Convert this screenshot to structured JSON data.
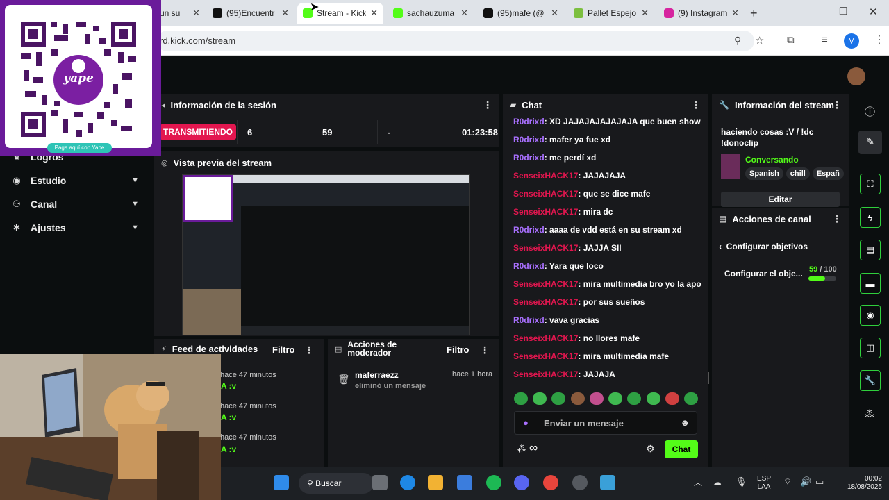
{
  "browser": {
    "tabs": [
      {
        "title": "un su",
        "color": "#e8e8e8"
      },
      {
        "title": "(95)Encuentr",
        "color": "#111111"
      },
      {
        "title": "Stream - Kick",
        "color": "#53fc18"
      },
      {
        "title": "sachauzuma",
        "color": "#53fc18"
      },
      {
        "title": "(95)mafe (@",
        "color": "#111111"
      },
      {
        "title": "Pallet Espejo",
        "color": "#7cbf3f"
      },
      {
        "title": "(9) Instagram",
        "color": "#d6249f"
      }
    ],
    "url": "rd.kick.com/stream",
    "profile_initial": "M"
  },
  "overlay_qr": {
    "brand": "yape",
    "caption": "Paga aquí con Yape"
  },
  "sidebar": {
    "items": [
      {
        "label": "Logros",
        "icon": "trophy-icon",
        "expandable": false
      },
      {
        "label": "Estudio",
        "icon": "video-icon",
        "expandable": true
      },
      {
        "label": "Canal",
        "icon": "users-icon",
        "expandable": true
      },
      {
        "label": "Ajustes",
        "icon": "gear-icon",
        "expandable": true
      }
    ]
  },
  "session": {
    "title": "Información de la sesión",
    "live_badge": "TRANSMITIENDO",
    "stats": [
      "6",
      "59",
      "-",
      "01:23:58"
    ]
  },
  "preview": {
    "title": "Vista previa del stream"
  },
  "activity": {
    "title": "Feed de actividades",
    "filter": "Filtro",
    "items": [
      {
        "text": "A :v",
        "time": "hace 47 minutos"
      },
      {
        "text": "A :v",
        "time": "hace 47 minutos"
      },
      {
        "text": "A :v",
        "time": "hace 47 minutos"
      }
    ]
  },
  "modactions": {
    "title_line1": "Acciones de",
    "title_line2": "moderador",
    "filter": "Filtro",
    "items": [
      {
        "user": "maferraezz",
        "action": "eliminó un mensaje",
        "time": "hace 1 hora"
      }
    ]
  },
  "chat": {
    "title": "Chat",
    "messages": [
      {
        "user": "R0drixd",
        "color": "#a970ff",
        "text": "XD JAJAJAJAJAJAJA que buen show"
      },
      {
        "user": "R0drixd",
        "color": "#a970ff",
        "text": "mafer ya fue xd"
      },
      {
        "user": "R0drixd",
        "color": "#a970ff",
        "text": "me perdí xd"
      },
      {
        "user": "SenseixHACK17",
        "color": "#e3164f",
        "text": "JAJAJAJA"
      },
      {
        "user": "SenseixHACK17",
        "color": "#e3164f",
        "text": "que se dice mafe"
      },
      {
        "user": "SenseixHACK17",
        "color": "#e3164f",
        "text": "mira dc"
      },
      {
        "user": "R0drixd",
        "color": "#a970ff",
        "text": "aaaa de vdd está en su stream xd"
      },
      {
        "user": "SenseixHACK17",
        "color": "#e3164f",
        "text": "JAJJA SII"
      },
      {
        "user": "R0drixd",
        "color": "#a970ff",
        "text": "Yara que loco"
      },
      {
        "user": "SenseixHACK17",
        "color": "#e3164f",
        "text": "mira multimedia bro yo la apoye"
      },
      {
        "user": "SenseixHACK17",
        "color": "#e3164f",
        "text": "por sus sueños"
      },
      {
        "user": "R0drixd",
        "color": "#a970ff",
        "text": "vava gracias"
      },
      {
        "user": "SenseixHACK17",
        "color": "#e3164f",
        "text": "no llores mafe"
      },
      {
        "user": "SenseixHACK17",
        "color": "#e3164f",
        "text": "mira multimedia mafe"
      },
      {
        "user": "SenseixHACK17",
        "color": "#e3164f",
        "text": "JAJAJA"
      }
    ],
    "input_placeholder": "Enviar un mensaje",
    "infinity": "∞",
    "send_label": "Chat"
  },
  "stream_info": {
    "title": "Información del stream",
    "stream_title": "haciendo cosas :V / !dc !donoclip",
    "category": "Conversando",
    "tags": [
      "Spanish",
      "chill",
      "Españ"
    ],
    "edit_label": "Editar"
  },
  "channel_actions": {
    "title": "Acciones de canal",
    "back_label": "Configurar objetivos",
    "goal_label": "Configurar el obje...",
    "goal_current": "59",
    "goal_total": "/ 100",
    "goal_fraction": 0.59
  },
  "taskbar": {
    "search_label": "Buscar",
    "lang_line1": "ESP",
    "lang_line2": "LAA",
    "time": "00:02",
    "date": "18/08/2025"
  },
  "colors": {
    "kick_green": "#53fc18",
    "live_red": "#e3164f",
    "panel_bg": "#18191c"
  }
}
